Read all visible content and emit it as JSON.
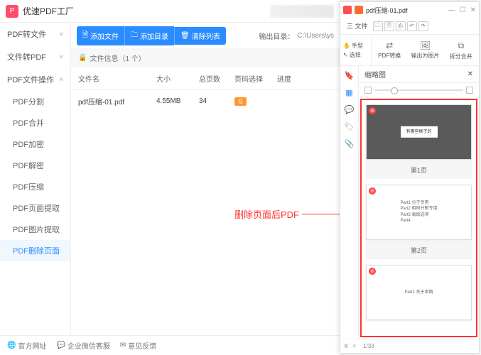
{
  "leftApp": {
    "title": "优速PDF工厂",
    "sidebar": {
      "groups": [
        {
          "label": "PDF转文件",
          "open": false
        },
        {
          "label": "文件转PDF",
          "open": false
        },
        {
          "label": "PDF文件操作",
          "open": true
        }
      ],
      "items": [
        {
          "label": "PDF分割"
        },
        {
          "label": "PDF合并"
        },
        {
          "label": "PDF加密"
        },
        {
          "label": "PDF解密"
        },
        {
          "label": "PDF压缩"
        },
        {
          "label": "PDF页面提取"
        },
        {
          "label": "PDF图片提取"
        },
        {
          "label": "PDF删除页面",
          "active": true
        }
      ]
    },
    "toolbar": {
      "addFile": "添加文件",
      "addDir": "添加目录",
      "clear": "清除列表",
      "outLabel": "输出目录：",
      "outPath": "C:\\Users\\ys"
    },
    "fileInfo": {
      "icon": "🔒",
      "label": "文件信息（1 个）"
    },
    "table": {
      "headers": {
        "name": "文件名",
        "size": "大小",
        "pages": "总页数",
        "sel": "页码选择",
        "prog": "进度"
      },
      "rows": [
        {
          "name": "pdf压缩-01.pdf",
          "size": "4.55MB",
          "pages": "34",
          "sel": "6"
        }
      ]
    },
    "footer": {
      "site": "官方网址",
      "wechat": "企业微信客服",
      "feedback": "意见反馈"
    },
    "annotation": "删除页面后PDF"
  },
  "rightApp": {
    "titlebar": {
      "filename": "pdf压缩-01.pdf"
    },
    "menu": {
      "fileBtn": "三 文件"
    },
    "tools": {
      "hand": "手型",
      "select": "选择",
      "convert": "PDF转换",
      "exportImg": "输出为图片",
      "split": "拆分合并"
    },
    "thumbPanel": {
      "title": "缩略图",
      "pages": [
        {
          "label": "第1页",
          "dark": true,
          "lines": [
            "有哪些框子的"
          ]
        },
        {
          "label": "第2页",
          "dark": false,
          "lines": [
            "Part1  分子专用",
            "Part2  相同分割专用",
            "Part3  高级选项",
            "Part4"
          ]
        },
        {
          "label": "",
          "dark": false,
          "lines": [
            "Part1  关于本期"
          ]
        }
      ]
    },
    "status": {
      "page": "1/33"
    }
  }
}
